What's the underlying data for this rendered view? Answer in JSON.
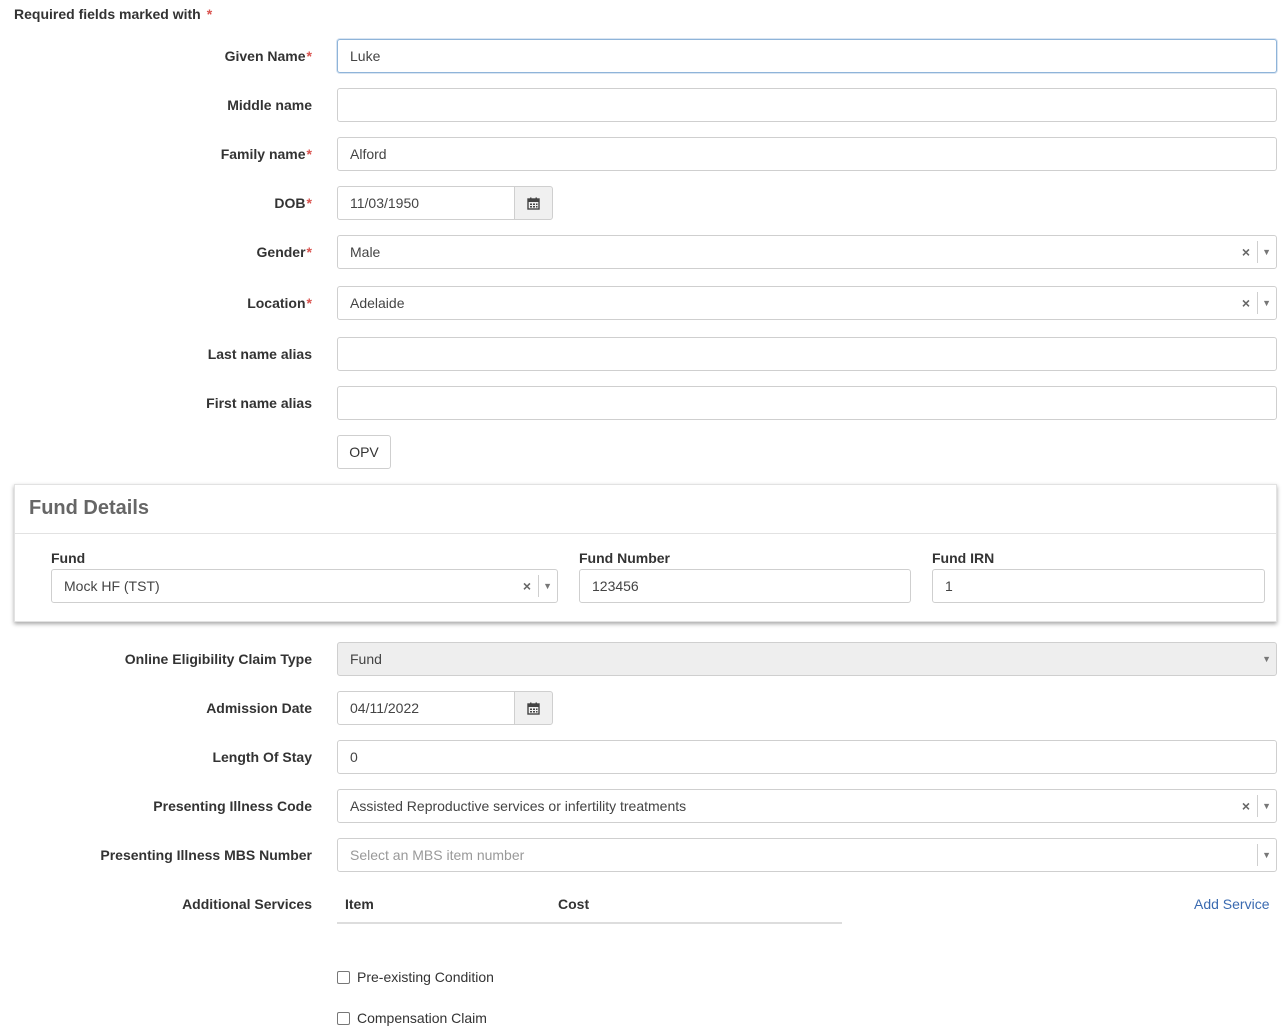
{
  "required_note": "Required fields marked with",
  "required_star": "*",
  "fields": {
    "given_name": {
      "label": "Given Name",
      "value": "Luke"
    },
    "middle_name": {
      "label": "Middle name",
      "value": ""
    },
    "family_name": {
      "label": "Family name",
      "value": "Alford"
    },
    "dob": {
      "label": "DOB",
      "value": "11/03/1950"
    },
    "gender": {
      "label": "Gender",
      "value": "Male"
    },
    "location": {
      "label": "Location",
      "value": "Adelaide"
    },
    "last_name_alias": {
      "label": "Last name alias",
      "value": ""
    },
    "first_name_alias": {
      "label": "First name alias",
      "value": ""
    }
  },
  "opv_button": "OPV",
  "fund_details": {
    "title": "Fund Details",
    "fund_label": "Fund",
    "fund_value": "Mock HF (TST)",
    "fund_number_label": "Fund Number",
    "fund_number_value": "123456",
    "fund_irn_label": "Fund IRN",
    "fund_irn_value": "1"
  },
  "eligibility": {
    "claim_type": {
      "label": "Online Eligibility Claim Type",
      "value": "Fund"
    },
    "admission_date": {
      "label": "Admission Date",
      "value": "04/11/2022"
    },
    "length_of_stay": {
      "label": "Length Of Stay",
      "value": "0"
    },
    "illness_code": {
      "label": "Presenting Illness Code",
      "value": "Assisted Reproductive services or infertility treatments"
    },
    "mbs_number": {
      "label": "Presenting Illness MBS Number",
      "placeholder": "Select an MBS item number"
    }
  },
  "additional_services": {
    "label": "Additional Services",
    "col_item": "Item",
    "col_cost": "Cost",
    "add_link": "Add Service"
  },
  "checkboxes": {
    "pre_existing": "Pre-existing Condition",
    "compensation": "Compensation Claim"
  },
  "icons": {
    "calendar": "calendar-icon",
    "clear": "×",
    "dropdown": "▼"
  }
}
